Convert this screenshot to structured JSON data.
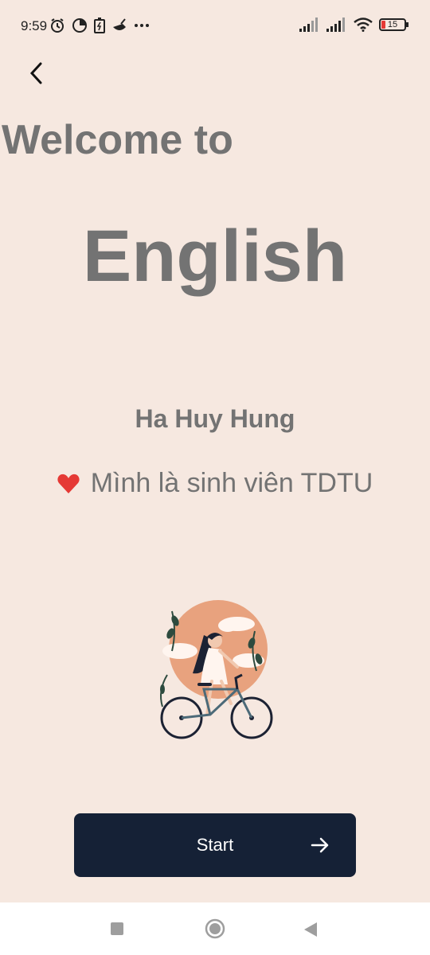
{
  "status_bar": {
    "time": "9:59",
    "battery": "15"
  },
  "welcome_text": "Welcome to",
  "app_name": "English",
  "author": "Ha Huy Hung",
  "tagline": "Mình là sinh viên TDTU",
  "start_button": {
    "label": "Start"
  },
  "colors": {
    "background": "#f6e8e0",
    "text": "#737373",
    "button": "#152136",
    "heart": "#e53935"
  }
}
